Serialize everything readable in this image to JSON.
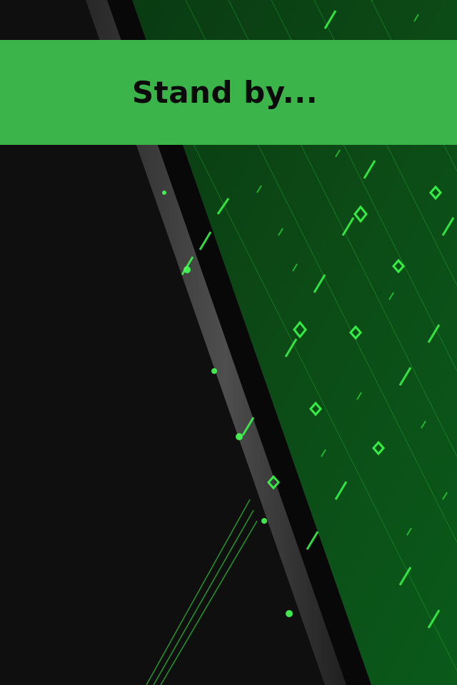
{
  "status": {
    "message": "Stand by..."
  },
  "theme": {
    "banner_color": "#3bb54a",
    "background_color": "#0e0e0e",
    "accent_green": "#39ff4a"
  },
  "background": {
    "description_icon": "green-digital-circuit-wallpaper"
  }
}
